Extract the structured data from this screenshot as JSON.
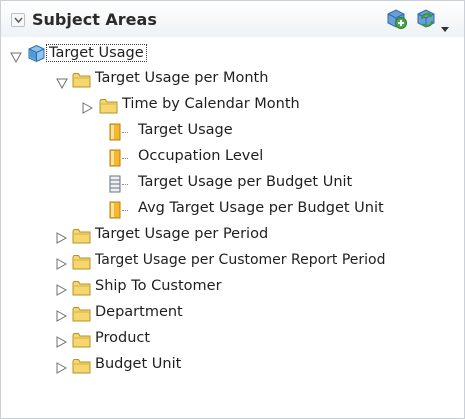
{
  "panel": {
    "title": "Subject Areas",
    "tools": [
      {
        "icon": "add-subject-area-icon"
      },
      {
        "icon": "refresh-icon"
      },
      {
        "icon": "dropdown-arrow-icon"
      }
    ]
  },
  "tree": {
    "root": {
      "label": "Target Usage",
      "icon": "cube-icon",
      "expanded": true,
      "selected": true
    },
    "items": [
      {
        "label": "Target Usage per Month",
        "level": 1,
        "type": "folder",
        "expanded": true
      },
      {
        "label": "Time by Calendar Month",
        "level": 2,
        "type": "folder",
        "expanded": false
      },
      {
        "label": "Target Usage",
        "level": 2,
        "type": "measure"
      },
      {
        "label": "Occupation Level",
        "level": 2,
        "type": "measure"
      },
      {
        "label": "Target Usage per Budget Unit",
        "level": 2,
        "type": "attribute"
      },
      {
        "label": "Avg Target Usage per Budget Unit",
        "level": 2,
        "type": "measure"
      },
      {
        "label": "Target Usage per Period",
        "level": 1,
        "type": "folder",
        "expanded": false
      },
      {
        "label": "Target Usage per Customer Report Period",
        "level": 1,
        "type": "folder",
        "expanded": false
      },
      {
        "label": "Ship To Customer",
        "level": 1,
        "type": "folder",
        "expanded": false
      },
      {
        "label": "Department",
        "level": 1,
        "type": "folder",
        "expanded": false
      },
      {
        "label": "Product",
        "level": 1,
        "type": "folder",
        "expanded": false
      },
      {
        "label": "Budget Unit",
        "level": 1,
        "type": "folder",
        "expanded": false
      }
    ]
  },
  "colors": {
    "folder": "#e8c44a",
    "measure": "#f0b429",
    "cube": "#3f8fd2",
    "accent_green": "#4aa84a",
    "accent_blue": "#3f8fd2"
  }
}
